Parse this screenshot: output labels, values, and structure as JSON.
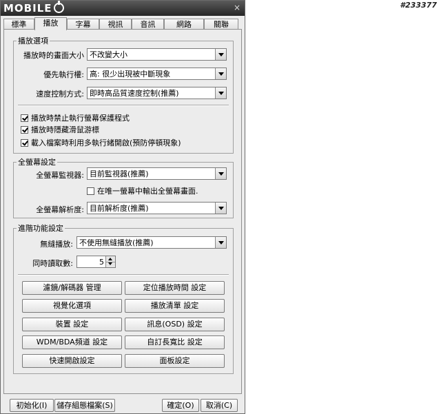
{
  "watermark": "#233377",
  "window": {
    "logo_text": "MOBILE",
    "close_glyph": "×"
  },
  "tabs": [
    {
      "label": "標準"
    },
    {
      "label": "播放"
    },
    {
      "label": "字幕"
    },
    {
      "label": "視訊"
    },
    {
      "label": "音訊"
    },
    {
      "label": "網路"
    },
    {
      "label": "關聯"
    }
  ],
  "playback": {
    "title": "播放選項",
    "screen_size_label": "播放時的畫面大小",
    "screen_size_value": "不改變大小",
    "priority_label": "優先執行權:",
    "priority_value": "高: 很少出現被中斷現象",
    "speed_label": "速度控制方式:",
    "speed_value": "即時高品質速度控制(推薦)",
    "check_screensaver": "播放時禁止執行螢幕保護程式",
    "check_hide_cursor": "播放時隱藏滑鼠游標",
    "check_multithread": "載入檔案時利用多執行緒開啟(預防停頓現象)"
  },
  "fullscreen": {
    "title": "全螢幕設定",
    "monitor_label": "全螢幕監視器:",
    "monitor_value": "目前監視器(推薦)",
    "single_check": "在唯一螢幕中輸出全螢幕畫面.",
    "resolution_label": "全螢幕解析度:",
    "resolution_value": "目前解析度(推薦)"
  },
  "advanced": {
    "title": "進階功能設定",
    "seamless_label": "無縫播放:",
    "seamless_value": "不使用無縫播放(推薦)",
    "read_count_label": "同時讀取數:",
    "read_count_value": "5",
    "buttons": {
      "filter": "濾鏡/解碼器 管理",
      "position": "定位播放時間 設定",
      "visual": "視覺化選項",
      "playlist": "播放清單 設定",
      "device": "裝置 設定",
      "osd": "訊息(OSD) 設定",
      "wdm": "WDM/BDA頻道 設定",
      "aspect": "自訂長寬比 設定",
      "quick": "快速開啟設定",
      "skin": "面板設定"
    }
  },
  "footer": {
    "reset": "初始化(I)",
    "save_config": "儲存組態檔案(S)",
    "ok": "確定(O)",
    "cancel": "取消(C)"
  }
}
